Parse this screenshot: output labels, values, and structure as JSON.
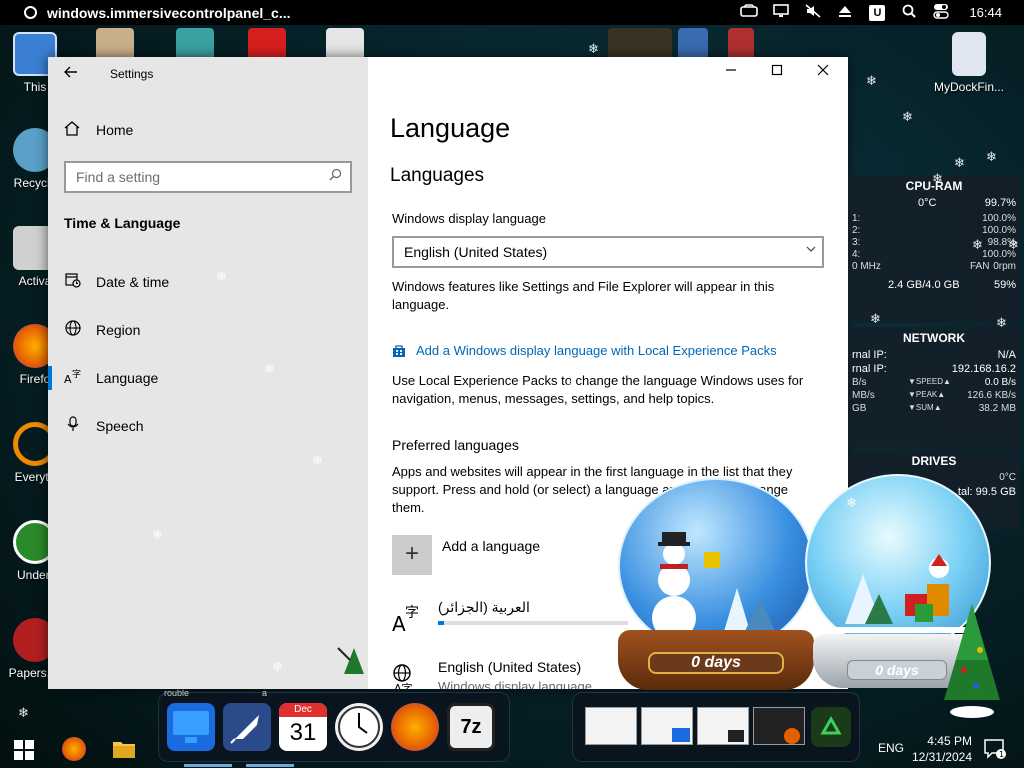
{
  "topbar": {
    "title": "windows.immersivecontrolpanel_c...",
    "clock": "16:44",
    "u_badge": "U"
  },
  "desktop_icons": [
    {
      "label": "This",
      "color": "#3a7fd4"
    },
    {
      "label": "Recycle",
      "color": "#5aa0c8"
    },
    {
      "label": "Activa",
      "color": "#d0d0d0"
    },
    {
      "label": "Firefo",
      "color": "#e66000"
    },
    {
      "label": "Everyth",
      "color": "#f08a00"
    },
    {
      "label": "Undert",
      "color": "#2a8a2a"
    },
    {
      "label": "Papers, P",
      "color": "#b02020"
    },
    {
      "label": "MyDockFin...",
      "color": "#dfe6f0"
    }
  ],
  "settings": {
    "window_title": "Settings",
    "home_label": "Home",
    "search_placeholder": "Find a setting",
    "section_title": "Time & Language",
    "nav": [
      {
        "label": "Date & time",
        "icon": "calendar-clock-icon"
      },
      {
        "label": "Region",
        "icon": "globe-icon"
      },
      {
        "label": "Language",
        "icon": "language-icon"
      },
      {
        "label": "Speech",
        "icon": "microphone-icon"
      }
    ],
    "page_title": "Language",
    "languages_heading": "Languages",
    "display_language_label": "Windows display language",
    "display_language_value": "English (United States)",
    "display_language_desc": "Windows features like Settings and File Explorer will appear in this language.",
    "lxp_link": "Add a Windows display language with Local Experience Packs",
    "lxp_desc": "Use Local Experience Packs to change the language Windows uses for navigation, menus, messages, settings, and help topics.",
    "preferred_heading": "Preferred languages",
    "preferred_desc": "Apps and websites will appear in the first language in the list that they support. Press and hold (or select) a language and drag to rearrange them.",
    "add_language": "Add a language",
    "languages": [
      {
        "name": "العربية (الجزائر)",
        "sub": ""
      },
      {
        "name": "English (United States)",
        "sub": "Windows display language"
      }
    ]
  },
  "widgets": {
    "cpu": {
      "title": "CPU-RAM",
      "temp": "0°C",
      "total": "99.7%",
      "cores": [
        {
          "label": "1:",
          "value": "100.0%"
        },
        {
          "label": "2:",
          "value": "100.0%"
        },
        {
          "label": "3:",
          "value": "98.8%"
        },
        {
          "label": "4:",
          "value": "100.0%"
        }
      ],
      "freq": "0 MHz",
      "fan": "0rpm",
      "fan_label": "FAN",
      "ram": "2.4 GB/4.0 GB",
      "ram_pct": "59%"
    },
    "network": {
      "title": "NETWORK",
      "internal_label": "rnal IP:",
      "internal_value": "N/A",
      "external_label": "rnal IP:",
      "external_value": "192.168.16.2",
      "rows": [
        {
          "l": "B/s",
          "c": "▼SPEED▲",
          "r": "0.0 B/s"
        },
        {
          "l": "MB/s",
          "c": "▼PEAK▲",
          "r": "126.6 KB/s"
        },
        {
          "l": "GB",
          "c": "▼SUM▲",
          "r": "38.2 MB"
        }
      ]
    },
    "drives": {
      "title": "DRIVES",
      "temp": "0°C",
      "total": "tal: 99.5 GB"
    }
  },
  "globes": [
    {
      "days": "0 days"
    },
    {
      "days": "0 days"
    }
  ],
  "dock": {
    "calendar_month": "Dec",
    "calendar_day": "31",
    "sevenzip_label": "7z"
  },
  "taskbar": {
    "lang": "ENG",
    "time": "4:45 PM",
    "date": "12/31/2024",
    "notif_count": "1"
  },
  "misc": {
    "behind_text_1": "rouble",
    "behind_text_2": "a"
  },
  "colors": {
    "accent": "#0078d7",
    "link": "#0067b8"
  }
}
